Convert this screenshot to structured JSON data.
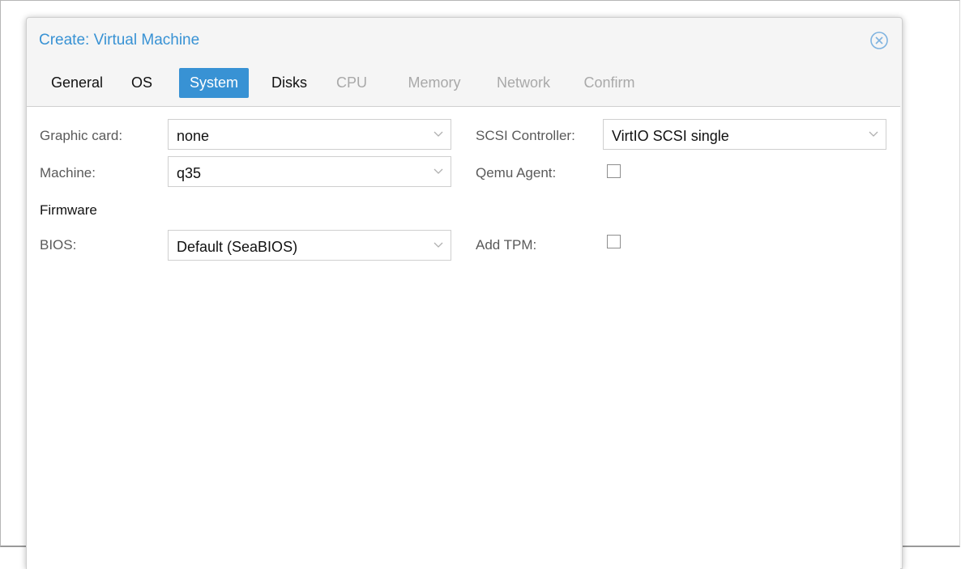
{
  "dialog": {
    "title": "Create: Virtual Machine",
    "close_icon": "circle-x-icon"
  },
  "tabs": [
    {
      "label": "General",
      "state": "enabled"
    },
    {
      "label": "OS",
      "state": "enabled"
    },
    {
      "label": "System",
      "state": "active"
    },
    {
      "label": "Disks",
      "state": "enabled"
    },
    {
      "label": "CPU",
      "state": "disabled"
    },
    {
      "label": "Memory",
      "state": "disabled"
    },
    {
      "label": "Network",
      "state": "disabled"
    },
    {
      "label": "Confirm",
      "state": "disabled"
    }
  ],
  "form": {
    "graphic_card": {
      "label": "Graphic card:",
      "value": "none"
    },
    "machine": {
      "label": "Machine:",
      "value": "q35"
    },
    "firmware_section": "Firmware",
    "bios": {
      "label": "BIOS:",
      "value": "Default (SeaBIOS)"
    },
    "scsi_controller": {
      "label": "SCSI Controller:",
      "value": "VirtIO SCSI single"
    },
    "qemu_agent": {
      "label": "Qemu Agent:",
      "checked": false
    },
    "add_tpm": {
      "label": "Add TPM:",
      "checked": false
    }
  },
  "colors": {
    "accent": "#3892d4",
    "dialog_bg": "#f5f5f5",
    "disabled_text": "#a9a9a9"
  }
}
